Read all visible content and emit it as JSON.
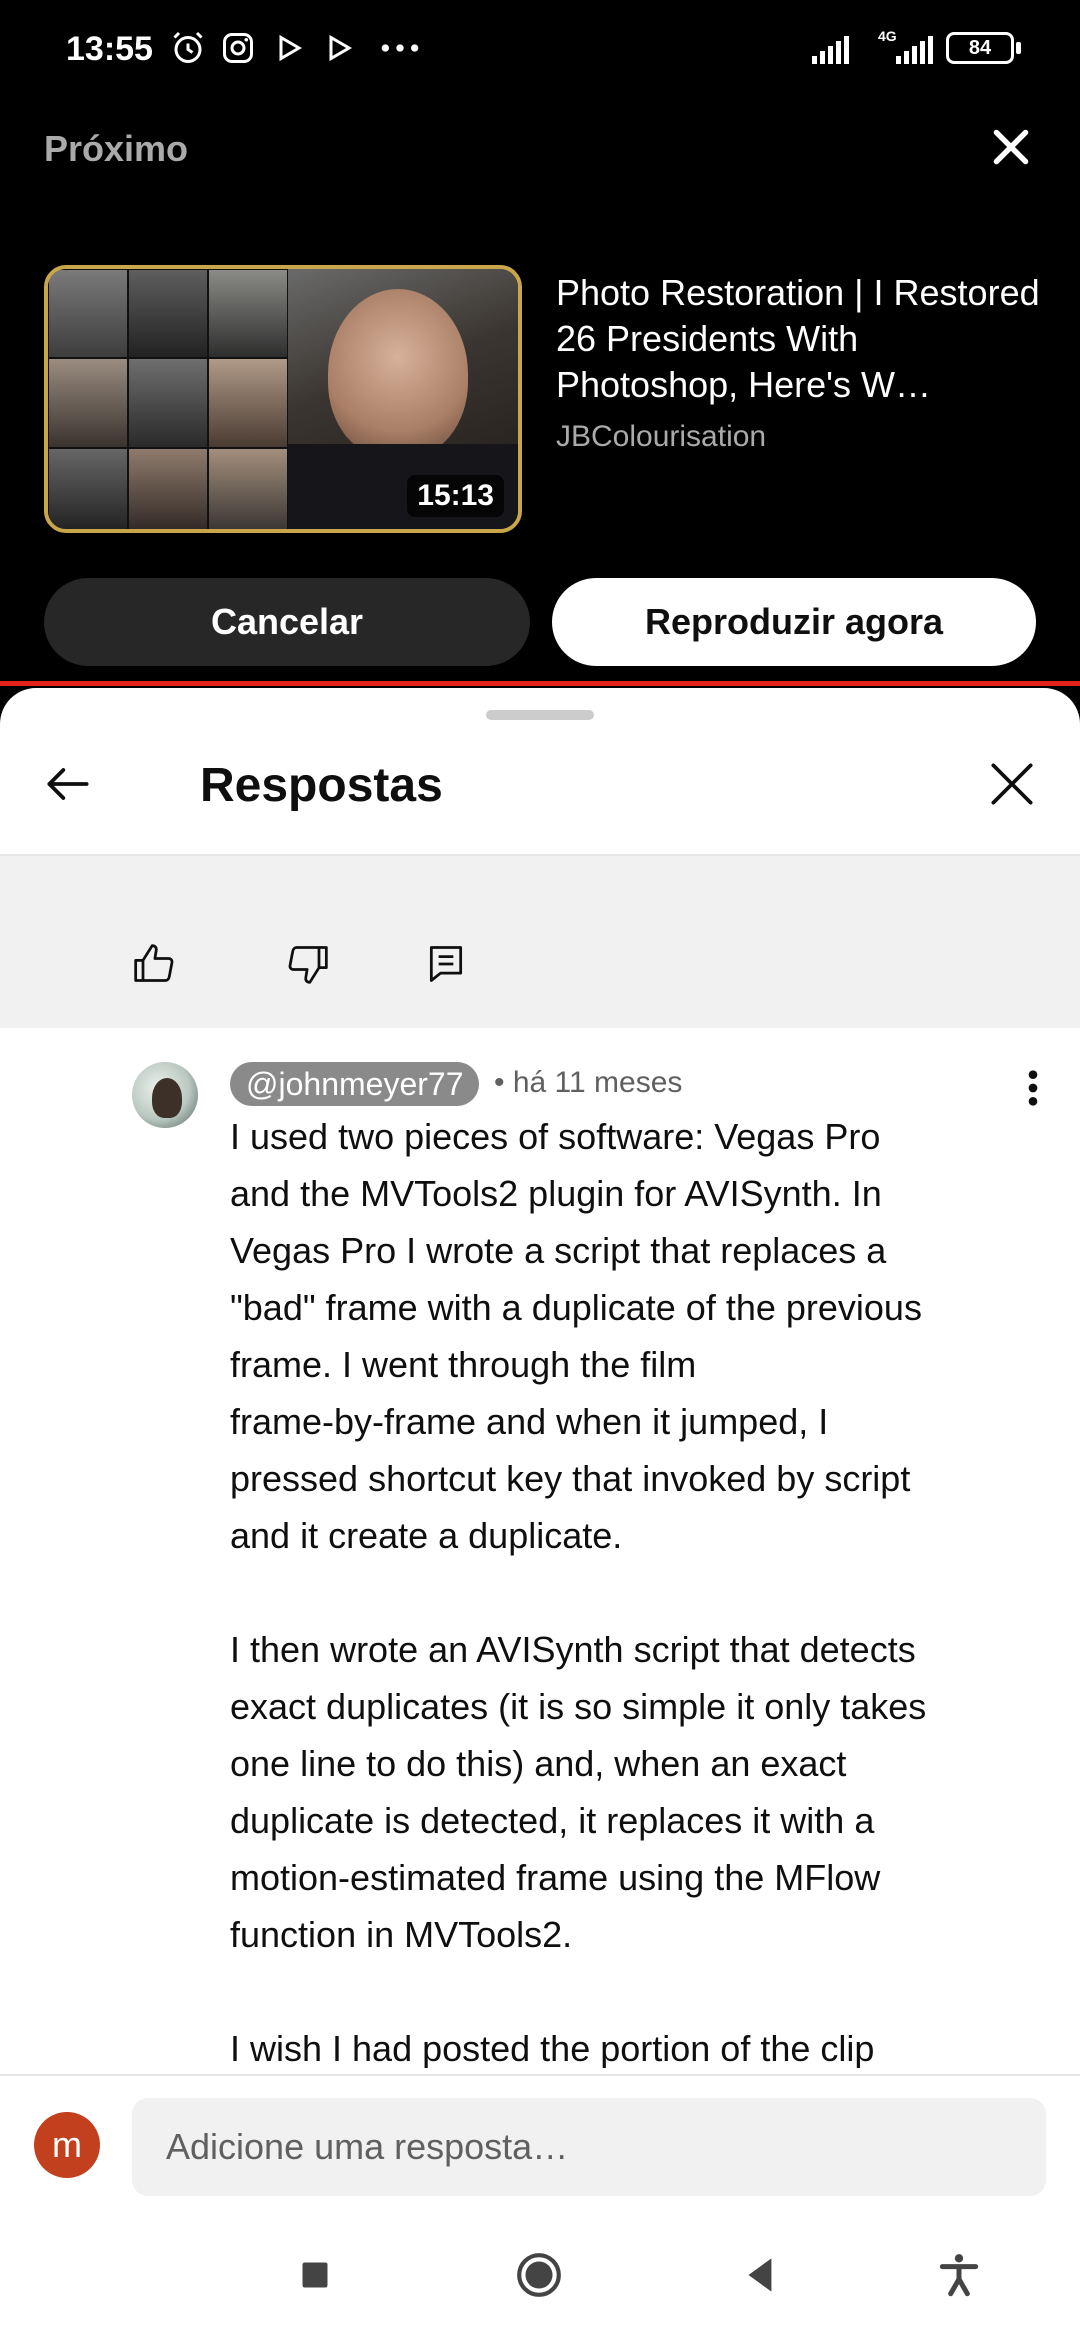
{
  "status": {
    "time": "13:55",
    "battery": "84",
    "network": "4G"
  },
  "upnext": {
    "label": "Próximo",
    "video_title": "Photo Restoration | I Restored 26 Presidents With Photoshop, Here's W…",
    "channel": "JBColourisation",
    "duration": "15:13",
    "cancel_label": "Cancelar",
    "play_label": "Reproduzir agora"
  },
  "sheet": {
    "title": "Respostas"
  },
  "comment": {
    "author": "@johnmeyer77",
    "time": "• há 11 meses",
    "text": "I used two pieces of software: Vegas Pro\nand the MVTools2 plugin for AVISynth. In\nVegas Pro I wrote a script that replaces a\n\"bad\" frame with a duplicate of the previous\nframe. I went through the film\nframe-by-frame and when it jumped, I\npressed shortcut key that invoked by script\nand it create a duplicate.\n\nI then wrote an AVISynth script that detects\nexact duplicates (it is so simple it only takes\none line to do this) and, when an exact\nduplicate is detected, it replaces it with a\nmotion-estimated frame using the MFlow\nfunction in MVTools2.\n\nI wish I had posted the portion of the clip"
  },
  "reply": {
    "user_initial": "m",
    "placeholder": "Adicione uma resposta…"
  },
  "colors": {
    "accent_red": "#e2231a",
    "gold_frame": "#c9a64a",
    "user_avatar": "#c3401e"
  }
}
